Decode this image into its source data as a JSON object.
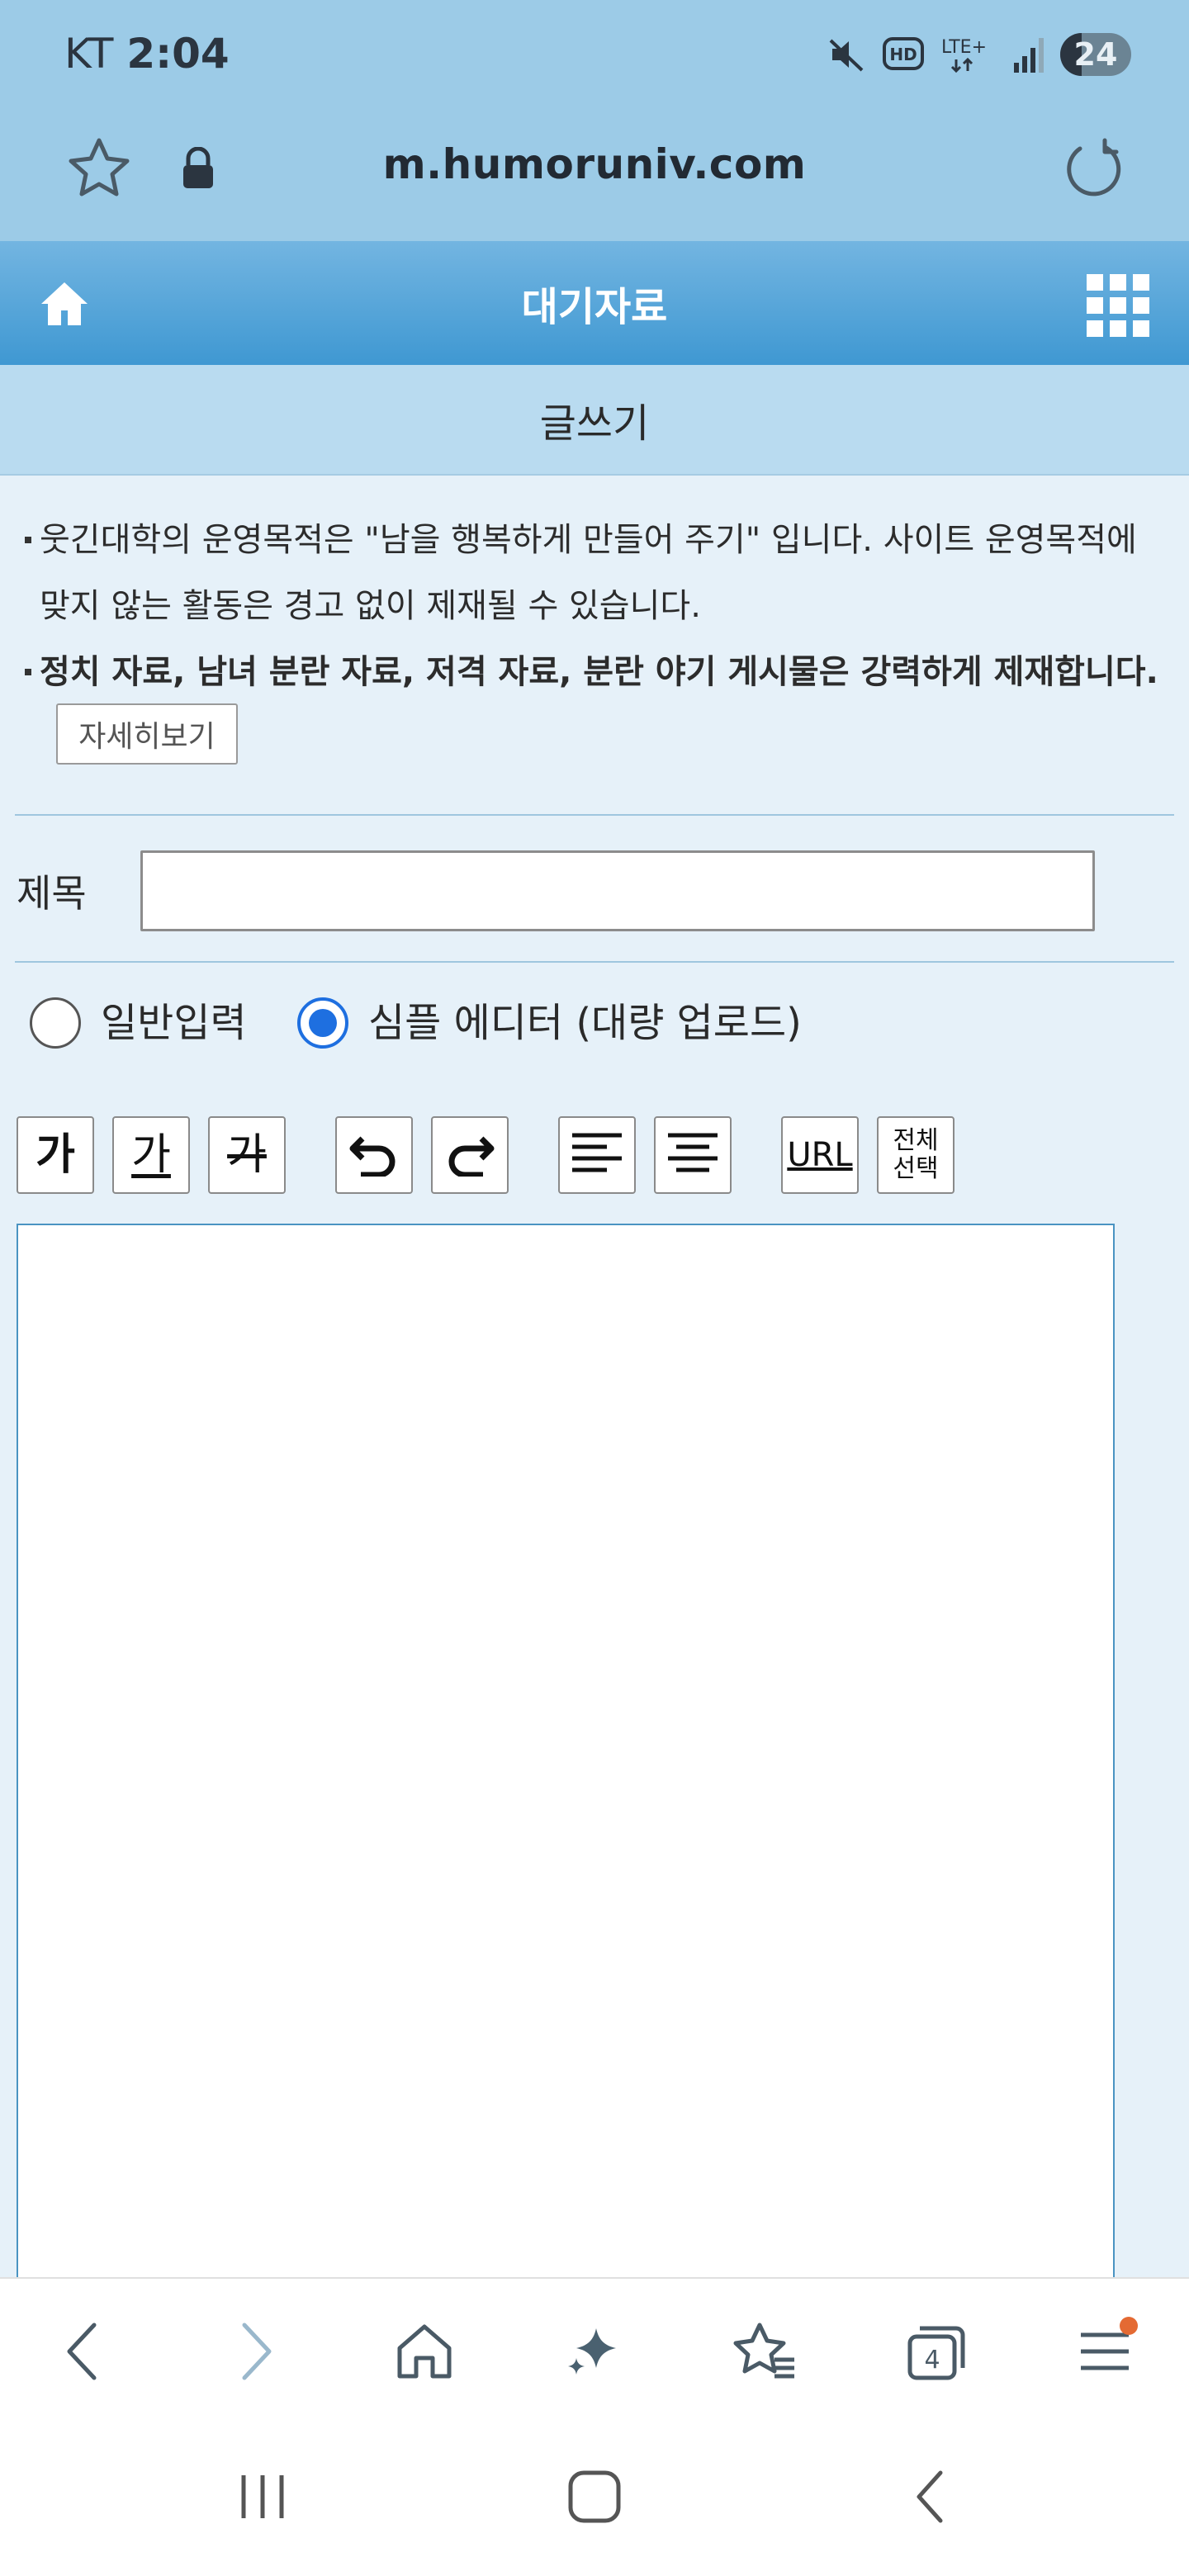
{
  "status_bar": {
    "carrier": "KT",
    "time": "2:04",
    "network": "LTE+",
    "hd_label": "HD",
    "battery": "24",
    "icons": [
      "mute-icon",
      "hd-voice-icon",
      "lte-plus-icon",
      "signal-icon",
      "battery-icon"
    ]
  },
  "address_bar": {
    "url": "m.humoruniv.com",
    "icons": [
      "star-icon",
      "lock-icon",
      "reload-icon"
    ]
  },
  "site_header": {
    "title": "대기자료",
    "icons": [
      "home-icon",
      "grid-menu-icon"
    ]
  },
  "subheader": {
    "title": "글쓰기"
  },
  "notice": {
    "line1": "웃긴대학의 운영목적은 \"남을 행복하게 만들어 주기\" 입니다. 사이트 운영목적에 맞지 않는 활동은 경고 없이 제재될 수 있습니다.",
    "line2": "정치 자료, 남녀 분란 자료, 저격 자료, 분란 야기 게시물은 강력하게 제재합니다.",
    "detail_button": "자세히보기"
  },
  "form": {
    "title_label": "제목",
    "title_value": "",
    "title_placeholder": "",
    "mode_options": [
      "일반입력",
      "심플 에디터 (대량 업로드)"
    ],
    "selected_mode": "심플 에디터 (대량 업로드)"
  },
  "toolbar": {
    "bold": "가",
    "underline": "가",
    "strike": "가",
    "url": "URL",
    "select_all_line1": "전체",
    "select_all_line2": "선택",
    "icons": [
      "undo-icon",
      "redo-icon",
      "align-left-icon",
      "align-center-icon"
    ]
  },
  "bottom_nav": {
    "tabs_count": "4",
    "icons": [
      "back-icon",
      "forward-icon",
      "home-icon",
      "sparkle-icon",
      "bookmarks-icon",
      "tabs-icon",
      "menu-icon"
    ],
    "colors": {
      "badge": "#e46a33",
      "forward_disabled": "#9ab8cc"
    }
  },
  "colors": {
    "top_bg": "#9ccbe7",
    "header_gradient_top": "#73b5e1",
    "header_gradient_bottom": "#3f98d2",
    "radio_selected": "#1e6fe0",
    "page_bg": "#e6f1f9"
  }
}
